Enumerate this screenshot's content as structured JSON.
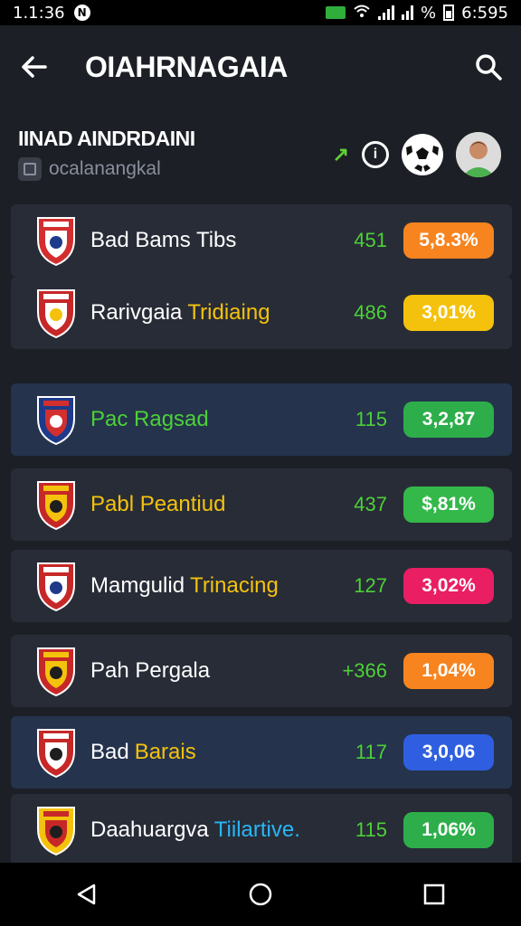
{
  "status_bar": {
    "time": "1.1:36",
    "right_time": "6:595",
    "battery_text": "%"
  },
  "header": {
    "title": "OIAHRNAGAIA"
  },
  "section": {
    "title": "IINAD AINDRDAINI",
    "subtitle": "ocalanangkal"
  },
  "rows": [
    {
      "name": "Bad Bams Tibs",
      "suffix": "",
      "suffix_color": "#ffffff",
      "name_color": "#ffffff",
      "score": "451",
      "score_color": "#4cd137",
      "pill": "5,8.3%",
      "pill_color": "#f7841e",
      "row_style": "dark",
      "crest_colors": [
        "#d32f2f",
        "#ffffff",
        "#1e3a8a"
      ]
    },
    {
      "name": "Rarivgaia",
      "suffix": "Tridiaing",
      "suffix_color": "#f4c20d",
      "name_color": "#ffffff",
      "score": "486",
      "score_color": "#4cd137",
      "pill": "3,01%",
      "pill_color": "#f4c20d",
      "row_style": "dark",
      "crest_colors": [
        "#c62828",
        "#ffffff",
        "#f4c20d"
      ]
    },
    {
      "name": "Pac Ragsad",
      "suffix": "",
      "suffix_color": "#4cd137",
      "name_color": "#4cd137",
      "score": "115",
      "score_color": "#4cd137",
      "pill": "3,2,87",
      "pill_color": "#2eae4a",
      "row_style": "blue",
      "crest_colors": [
        "#1e3a8a",
        "#d32f2f",
        "#ffffff"
      ]
    },
    {
      "name": "Pabl Peantiud",
      "suffix": "",
      "suffix_color": "#f4c20d",
      "name_color": "#f4c20d",
      "score": "437",
      "score_color": "#4cd137",
      "pill": "$,81%",
      "pill_color": "#34b84a",
      "row_style": "dark",
      "crest_colors": [
        "#c62828",
        "#f4c20d",
        "#1e1e1e"
      ]
    },
    {
      "name": "Mamgulid",
      "suffix": "Trinacing",
      "suffix_color": "#f4c20d",
      "name_color": "#ffffff",
      "score": "127",
      "score_color": "#4cd137",
      "pill": "3,02%",
      "pill_color": "#e91e63",
      "row_style": "dark",
      "crest_colors": [
        "#c62828",
        "#ffffff",
        "#1e3a8a"
      ]
    },
    {
      "name": "Pah Pergala",
      "suffix": "",
      "suffix_color": "#ffffff",
      "name_color": "#ffffff",
      "score": "+366",
      "score_color": "#4cd137",
      "pill": "1,04%",
      "pill_color": "#f7841e",
      "row_style": "dark",
      "crest_colors": [
        "#c62828",
        "#f4c20d",
        "#1e1e1e"
      ]
    },
    {
      "name": "Bad",
      "suffix": "Barais",
      "suffix_color": "#f4c20d",
      "name_color": "#ffffff",
      "score": "117",
      "score_color": "#4cd137",
      "pill": "3,0,06",
      "pill_color": "#2f5fe0",
      "row_style": "blue",
      "crest_colors": [
        "#c62828",
        "#ffffff",
        "#1e1e1e"
      ]
    },
    {
      "name": "Daahuargva",
      "suffix": "Tiilartive.",
      "suffix_color": "#29b6f6",
      "name_color": "#ffffff",
      "score": "115",
      "score_color": "#4cd137",
      "pill": "1,06%",
      "pill_color": "#2eae4a",
      "row_style": "dark",
      "crest_colors": [
        "#f4c20d",
        "#c62828",
        "#1e1e1e"
      ]
    }
  ]
}
